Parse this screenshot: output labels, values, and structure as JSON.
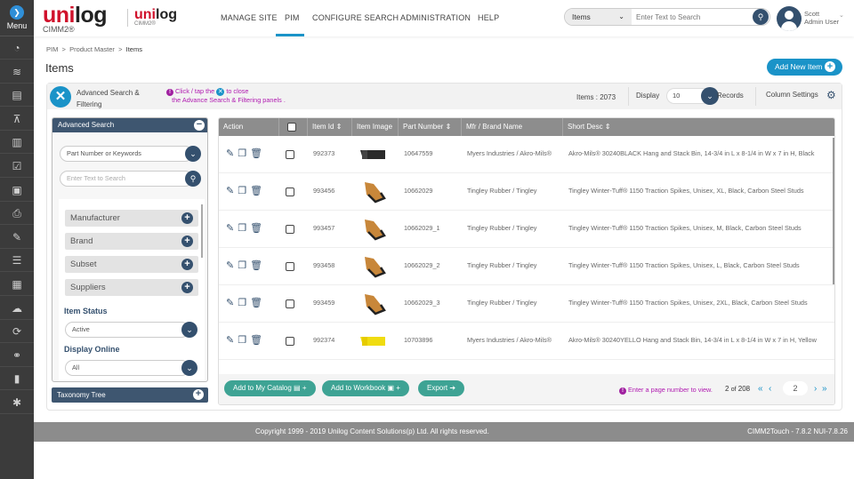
{
  "sidebar": {
    "menu_label": "Menu",
    "items": [
      {
        "icon": "dashboard-icon",
        "glyph": "◔"
      },
      {
        "icon": "layers-icon",
        "glyph": "≋"
      },
      {
        "icon": "document-icon",
        "glyph": "▤"
      },
      {
        "icon": "sitemap-icon",
        "glyph": "⊼"
      },
      {
        "icon": "book-open-icon",
        "glyph": "▥"
      },
      {
        "icon": "clipboard-check-icon",
        "glyph": "☑"
      },
      {
        "icon": "images-icon",
        "glyph": "▣"
      },
      {
        "icon": "print-icon",
        "glyph": "⎙"
      },
      {
        "icon": "wrench-icon",
        "glyph": "✎"
      },
      {
        "icon": "list-icon",
        "glyph": "☰"
      },
      {
        "icon": "warehouse-icon",
        "glyph": "▦"
      },
      {
        "icon": "cloud-user-icon",
        "glyph": "☁"
      },
      {
        "icon": "sync-icon",
        "glyph": "⟳"
      },
      {
        "icon": "handshake-icon",
        "glyph": "⚭"
      },
      {
        "icon": "chart-icon",
        "glyph": "▮"
      },
      {
        "icon": "bug-icon",
        "glyph": "✱"
      }
    ]
  },
  "header": {
    "logo_main": "unilog",
    "logo_sub": "CIMM2®",
    "logo2_main": "unilog",
    "logo2_sub": "CIMM2®",
    "nav": [
      "MANAGE SITE",
      "PIM",
      "CONFIGURE SEARCH",
      "ADMINISTRATION",
      "HELP"
    ],
    "active_nav": "PIM",
    "search_scope": "Items",
    "search_placeholder": "Enter Text to Search",
    "user_name": "Scott",
    "user_role": "Admin User"
  },
  "breadcrumb": [
    "PIM",
    "Product Master",
    "Items"
  ],
  "page_title": "Items",
  "add_new_label": "Add New Item",
  "toolbar": {
    "adv_title": "Advanced Search & Filtering",
    "hint_1": "Click / tap the",
    "hint_2": "to close",
    "hint_3": "the Advance Search & Filtering panels .",
    "items_count": "Items : 2073",
    "display_label": "Display",
    "display_value": "10",
    "records_label": "Records",
    "column_settings": "Column Settings"
  },
  "advanced_search": {
    "title": "Advanced Search",
    "search_by": "Part Number or Keywords",
    "search_placeholder": "Enter Text to Search",
    "facets": [
      "Manufacturer",
      "Brand",
      "Subset",
      "Suppliers"
    ],
    "item_status_label": "Item Status",
    "item_status_value": "Active",
    "display_online_label": "Display Online",
    "display_online_value": "All",
    "taxonomy_title": "Taxonomy Tree"
  },
  "table": {
    "columns": [
      "Action",
      "",
      "Item Id",
      "Item Image",
      "Part Number",
      "Mfr / Brand Name",
      "Short Desc"
    ],
    "rows": [
      {
        "id": "992373",
        "image": "black-bin",
        "part": "10647559",
        "mfr": "Myers Industries / Akro-Mils®",
        "desc": "Akro-Mils® 30240BLACK Hang and Stack Bin, 14-3/4 in L x 8-1/4 in W x 7 in H, Black"
      },
      {
        "id": "993456",
        "image": "traction-spikes",
        "part": "10662029",
        "mfr": "Tingley Rubber / Tingley",
        "desc": "Tingley Winter-Tuff® 1150 Traction Spikes, Unisex, XL, Black, Carbon Steel Studs"
      },
      {
        "id": "993457",
        "image": "traction-spikes",
        "part": "10662029_1",
        "mfr": "Tingley Rubber / Tingley",
        "desc": "Tingley Winter-Tuff® 1150 Traction Spikes, Unisex, M, Black, Carbon Steel Studs"
      },
      {
        "id": "993458",
        "image": "traction-spikes",
        "part": "10662029_2",
        "mfr": "Tingley Rubber / Tingley",
        "desc": "Tingley Winter-Tuff® 1150 Traction Spikes, Unisex, L, Black, Carbon Steel Studs"
      },
      {
        "id": "993459",
        "image": "traction-spikes",
        "part": "10662029_3",
        "mfr": "Tingley Rubber / Tingley",
        "desc": "Tingley Winter-Tuff® 1150 Traction Spikes, Unisex, 2XL, Black, Carbon Steel Studs"
      },
      {
        "id": "992374",
        "image": "yellow-bin",
        "part": "10703896",
        "mfr": "Myers Industries / Akro-Mils®",
        "desc": "Akro-Mils® 30240YELLO Hang and Stack Bin, 14-3/4 in L x 8-1/4 in W x 7 in H, Yellow"
      }
    ]
  },
  "table_footer": {
    "add_catalog": "Add to My Catalog",
    "add_workbook": "Add to Workbook",
    "export": "Export",
    "page_hint": "Enter a page number to view.",
    "current_page": "2",
    "of_label": "of",
    "total_pages": "208",
    "page_input": "2"
  },
  "footer": {
    "copyright": "Copyright 1999 - 2019 Unilog Content Solutions(p) Ltd. All rights reserved.",
    "version": "CIMM2Touch - 7.8.2 NUI-7.8.26"
  },
  "colors": {
    "accent": "#1a93c8",
    "navy": "#34506e",
    "teal": "#3ea394",
    "hint": "#b01ab0",
    "sidebar": "#3b3b3b"
  }
}
